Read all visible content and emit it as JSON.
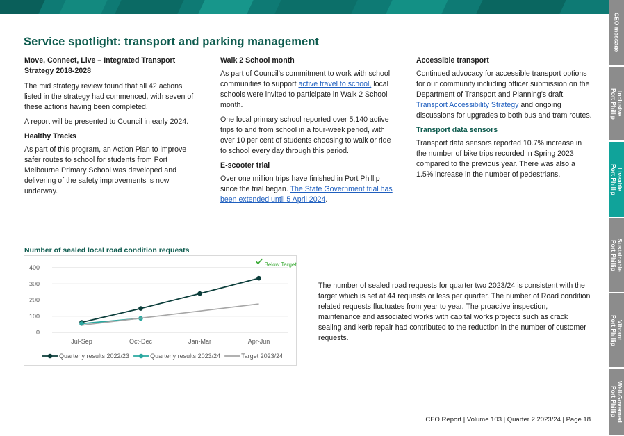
{
  "page": {
    "title": "Service spotlight: transport and parking management",
    "footer": "CEO Report | Volume 103 | Quarter 2 2023/24 | Page 18"
  },
  "side_tabs": [
    {
      "label": "CEO message",
      "active": false
    },
    {
      "label": "Inclusive\nPort Phillip",
      "active": false
    },
    {
      "label": "Liveable\nPort Phillip",
      "active": true
    },
    {
      "label": "Sustainable\nPort Phillip",
      "active": false
    },
    {
      "label": "Vibrant\nPort Phillip",
      "active": false
    },
    {
      "label": "Well-Governed\nPort Phillip",
      "active": false
    }
  ],
  "colors": {
    "accent": "#0f5c4f",
    "teal": "#10a39a",
    "tab_grey": "#8c8c8c",
    "link": "#1f5fbf"
  },
  "col1": {
    "heading1": "Move, Connect, Live – Integrated Transport Strategy 2018-2028",
    "para1": "The mid strategy review found that all 42 actions listed in the strategy had commenced, with seven of these actions having been completed.",
    "para2": "A report will be presented to Council in early 2024.",
    "heading2": "Healthy Tracks",
    "para3": "As part of this program, an Action Plan to improve safer routes to school for students from Port Melbourne Primary School was developed and delivering of the safety improvements is now underway."
  },
  "col2": {
    "heading1": "Walk 2 School month",
    "para1_before": "As part of Council’s commitment to work with school communities to support ",
    "para1_link": "active travel to school,",
    "para1_after": " local schools were invited to participate in Walk 2 School month.",
    "para2": "One local primary school reported over 5,140 active trips to and from school in a four-week period, with over 10 per cent of students choosing to walk or ride to school every day through this period.",
    "heading2": "E-scooter trial",
    "para3_before": "Over one million trips have finished in Port Phillip since the trial began. ",
    "para3_link": "The State Government trial has been extended until 5 April 2024",
    "para3_after": "."
  },
  "col3": {
    "heading1": "Accessible transport",
    "para1_before": "Continued advocacy for accessible transport options for our community including officer submission on the Department of Transport and Planning’s draft ",
    "para1_link": "Transport Accessibility Strategy",
    "para1_after": " and ongoing discussions for upgrades to both bus and tram routes.",
    "heading2": "Transport data sensors",
    "para2": "Transport data sensors reported 10.7% increase in the number of bike trips recorded in Spring 2023 compared to the previous year. There was also a 1.5% increase in the number of pedestrians."
  },
  "right_paragraph": "The number of sealed road requests for quarter two 2023/24 is consistent with the target which is set at 44 requests or less per quarter. The number of Road condition related requests fluctuates from year to year. The proactive inspection, maintenance and associated works with capital works projects such as crack sealing and kerb repair had contributed to the reduction in the number of customer requests.",
  "chart_data": {
    "type": "line",
    "title": "Number of sealed local road condition requests",
    "categories": [
      "Jul-Sep",
      "Oct-Dec",
      "Jan-Mar",
      "Apr-Jun"
    ],
    "ylim": [
      0,
      400
    ],
    "yticks": [
      0,
      100,
      200,
      300,
      400
    ],
    "grid": true,
    "legend_position": "bottom",
    "annotation": "Below Target",
    "series": [
      {
        "name": "Quarterly results 2022/23",
        "values": [
          62,
          148,
          240,
          335
        ],
        "color": "#0b3d3a",
        "markers": true
      },
      {
        "name": "Quarterly results 2023/24",
        "values": [
          54,
          87,
          null,
          null
        ],
        "color": "#2aa8a0",
        "markers": true
      },
      {
        "name": "Target 2023/24",
        "values": [
          44,
          88,
          132,
          176
        ],
        "color": "#a6a6a6",
        "markers": false
      }
    ]
  }
}
